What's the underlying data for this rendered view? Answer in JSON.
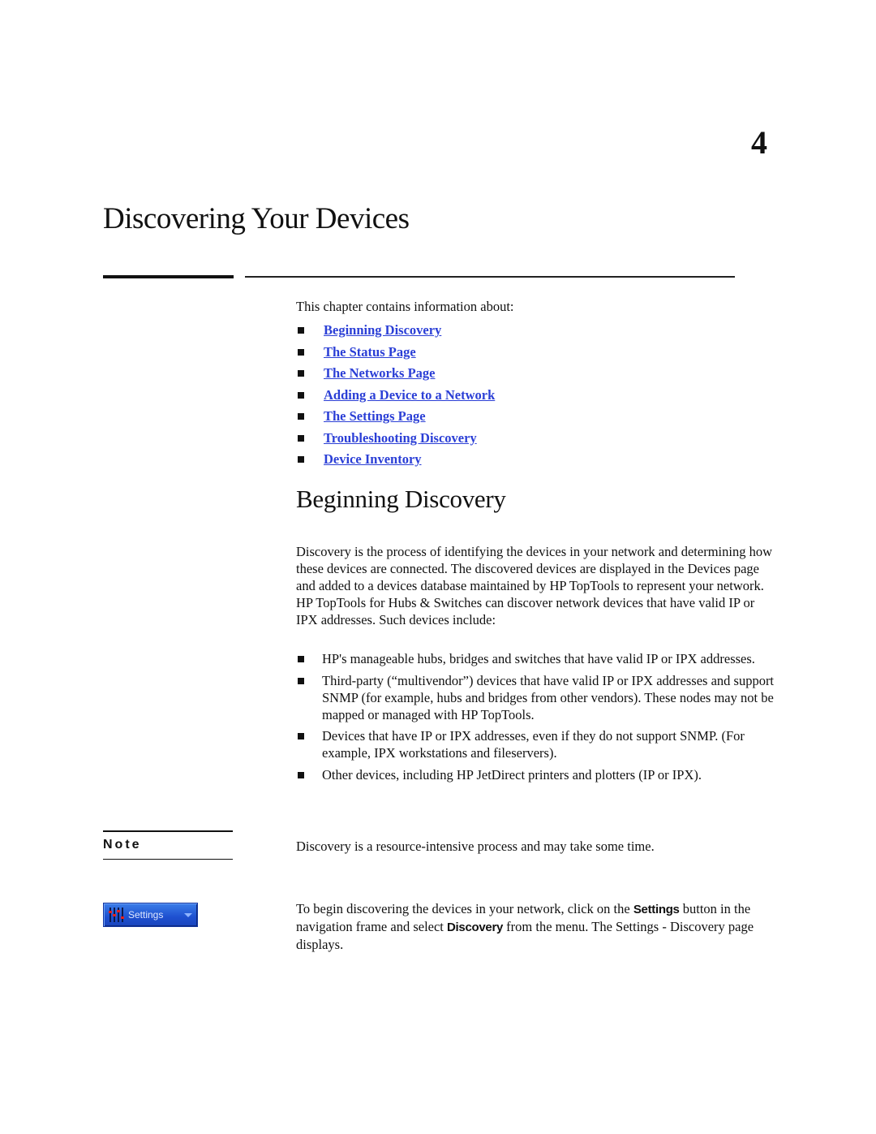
{
  "chapter": {
    "number": "4",
    "title": "Discovering Your Devices"
  },
  "intro": "This chapter contains information about:",
  "toc": [
    {
      "label": "Beginning Discovery"
    },
    {
      "label": "The Status Page"
    },
    {
      "label": "The Networks Page"
    },
    {
      "label": "Adding a Device to a Network"
    },
    {
      "label": "The Settings Page"
    },
    {
      "label": "Troubleshooting Discovery"
    },
    {
      "label": "Device Inventory"
    }
  ],
  "link_color": "#2b3fd6",
  "section": {
    "title": "Beginning Discovery",
    "paragraph1": "Discovery is the process of identifying the devices in your network and determining how these devices are connected. The discovered devices are displayed in the Devices page and added to a devices database maintained by HP TopTools to represent your network. HP TopTools for Hubs & Switches can discover network devices that have valid IP or IPX addresses. Such devices include:",
    "bullets": [
      "HP's manageable hubs, bridges and switches that have valid IP or IPX addresses.",
      "Third-party (“multivendor”) devices that have valid IP or IPX addresses and support SNMP (for example, hubs and bridges from other vendors). These nodes may not be mapped or managed with HP TopTools.",
      "Devices that have IP or IPX addresses, even if they do not support SNMP. (For example, IPX workstations and fileservers).",
      "Other devices, including HP JetDirect printers and plotters (IP or IPX)."
    ],
    "note": {
      "label": "Note",
      "text": "Discovery is a resource-intensive process and may take some time."
    },
    "settings_button": {
      "label": "Settings",
      "icon": "sliders-icon"
    },
    "paragraph2": {
      "part1": "To begin discovering the devices in your network, click on the ",
      "bold1": "Settings",
      "part2": " button in the navigation frame and select ",
      "bold2": "Discovery",
      "part3": " from the menu. The Settings - Discovery page displays."
    }
  }
}
